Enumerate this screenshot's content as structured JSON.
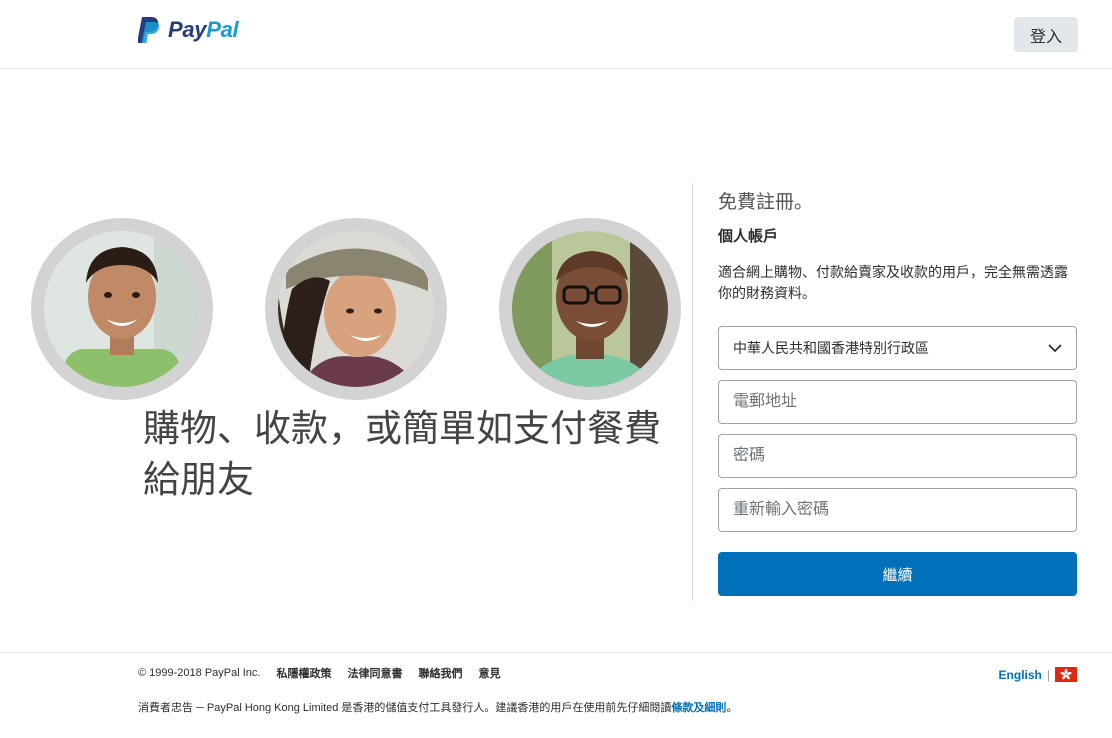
{
  "header": {
    "logo_text_pay": "Pay",
    "logo_text_pal": "Pal",
    "login_label": "登入"
  },
  "hero": {
    "headline": "購物、收款，或簡單如支付餐費給朋友"
  },
  "signup": {
    "title": "免費註冊。",
    "account_type": "個人帳戶",
    "description": "適合網上購物、付款給賣家及收款的用戶，完全無需透露你的財務資料。",
    "country_value": "中華人民共和國香港特別行政區",
    "email_placeholder": "電郵地址",
    "password_placeholder": "密碼",
    "confirm_password_placeholder": "重新輸入密碼",
    "continue_label": "繼續"
  },
  "footer": {
    "copyright": "© 1999-2018 PayPal Inc.",
    "links": [
      "私隱權政策",
      "法律同意書",
      "聯絡我們",
      "意見"
    ],
    "language": "English",
    "language_separator": "|",
    "disclaimer_prefix": "消費者忠告 ─ PayPal Hong Kong Limited 是香港的儲值支付工具發行人。建議香港的用戶在使用前先仔細閱讀",
    "disclaimer_link": "條款及細則",
    "disclaimer_suffix": "。"
  },
  "icons": {
    "logo": "paypal-logo-icon",
    "chevron": "chevron-down-icon",
    "flag": "hong-kong-flag-icon"
  },
  "colors": {
    "brand_dark": "#253b80",
    "brand_light": "#179bd7",
    "primary_button": "#0070ba",
    "secondary_button": "#e1e7eb",
    "avatar_ring": "#d3d3d3"
  }
}
